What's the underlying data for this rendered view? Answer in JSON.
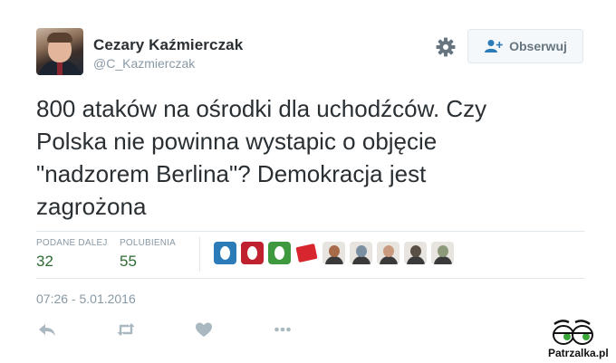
{
  "author": {
    "name": "Cezary Kaźmierczak",
    "handle": "@C_Kazmierczak"
  },
  "follow_button": {
    "label": "Obserwuj",
    "icon": "follow-user-icon"
  },
  "settings_icon": "gear-icon",
  "tweet": {
    "text_lines": [
      "800 ataków na ośrodki dla uchodźców. Czy",
      "Polska nie powinna wystapic o objęcie",
      "\"nadzorem Berlina\"? Demokracja jest",
      "zagrożona"
    ]
  },
  "stats": {
    "retweets_label": "PODANE DALEJ",
    "retweets_value": "32",
    "likes_label": "POLUBIENIA",
    "likes_value": "55"
  },
  "likers": [
    {
      "kind": "egg",
      "color": "#2b7bb9"
    },
    {
      "kind": "egg",
      "color": "#c0212f"
    },
    {
      "kind": "egg",
      "color": "#3f9a3f"
    },
    {
      "kind": "logo",
      "color": "#d8262e"
    },
    {
      "kind": "photo",
      "color": "#a86b4a"
    },
    {
      "kind": "photo",
      "color": "#7a8fa0"
    },
    {
      "kind": "photo",
      "color": "#c99a7e"
    },
    {
      "kind": "photo",
      "color": "#5b5045"
    },
    {
      "kind": "photo",
      "color": "#8c9a7a"
    }
  ],
  "timestamp": "07:26 - 5.01.2016",
  "actions": [
    "reply-icon",
    "retweet-icon",
    "like-icon",
    "more-icon"
  ],
  "watermark": {
    "text": "Patrzalka.pl"
  },
  "colors": {
    "text": "#292f33",
    "secondary": "#8899a6",
    "stat_value": "#2e6b32",
    "border": "#e1e8ed",
    "icon": "#aab8c2"
  }
}
